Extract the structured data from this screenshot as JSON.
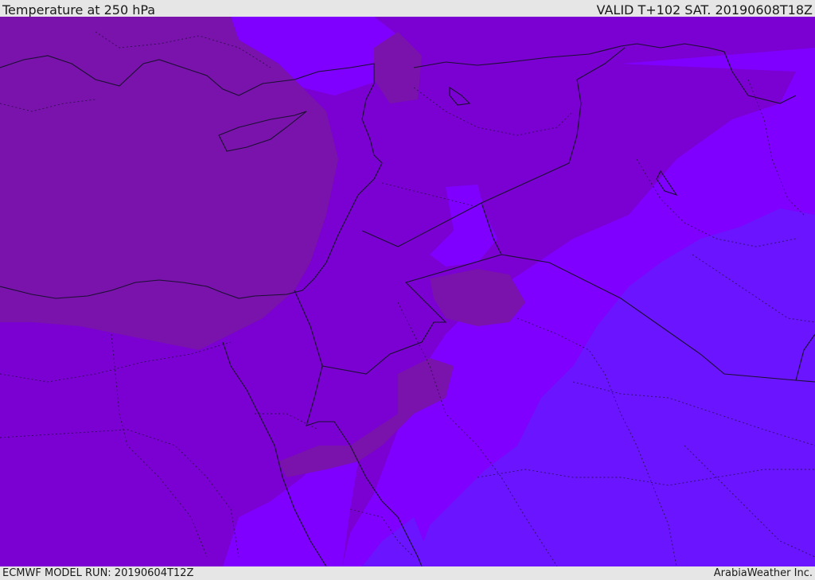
{
  "header": {
    "title": "Temperature at 250 hPa",
    "valid": "VALID T+102 SAT. 20190608T18Z"
  },
  "footer": {
    "model_run": "ECMWF MODEL RUN: 20190604T12Z",
    "provider": "ArabiaWeather Inc."
  },
  "map": {
    "field": "temperature",
    "level": "250 hPa",
    "colors": {
      "warm_region": "#7a12ac",
      "mid_region": "#7b00d2",
      "violet_region": "#7f00ff",
      "cool_region": "#6a14ff",
      "border_line": "#1a1030"
    }
  }
}
